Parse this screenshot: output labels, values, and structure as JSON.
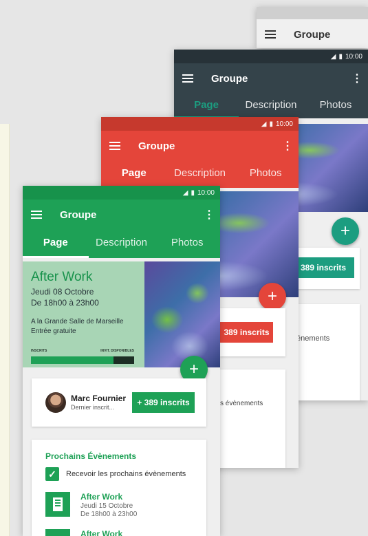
{
  "screen_4": {
    "app_title": "Groupe"
  },
  "screen_3": {
    "status_time": "10:00",
    "app_title": "Groupe",
    "tabs": [
      "Page",
      "Description",
      "Photos"
    ],
    "subscribers_button": "389 inscrits",
    "events_partial": "énements"
  },
  "screen_2": {
    "status_time": "10:00",
    "app_title": "Groupe",
    "tabs": [
      "Page",
      "Description",
      "Photos"
    ],
    "subscribers_button": "389 inscrits",
    "events_partial": "s évènements"
  },
  "screen_1": {
    "status_time": "10:00",
    "app_title": "Groupe",
    "tabs": [
      "Page",
      "Description",
      "Photos"
    ],
    "event": {
      "title": "After Work",
      "date": "Jeudi 08 Octobre",
      "time": "De 18h00 à 23h00",
      "location": "A la Grande Salle de Marseille",
      "price": "Entrée gratuite",
      "bar_left_label": "INSCRITS",
      "bar_right_label": "INVIT. DISPONIBLES",
      "fill_fraction": 0.8
    },
    "member": {
      "name": "Marc Fournier",
      "subtitle": "Dernier inscrit..."
    },
    "subscribers_button": "+ 389 inscrits",
    "upcoming": {
      "heading": "Prochains Évènements",
      "checkbox_label": "Recevoir les prochains évènements",
      "items": [
        {
          "title": "After Work",
          "date": "Jeudi 15 Octobre",
          "time": "De 18h00 à 23h00"
        },
        {
          "title": "After Work"
        }
      ]
    }
  },
  "colors": {
    "green": "#1ea156",
    "red": "#e4453a",
    "dark": "#34434a",
    "teal": "#1c9d80"
  },
  "icons": [
    "menu-icon",
    "more-vert-icon",
    "signal-icon",
    "battery-icon",
    "add-icon",
    "check-icon",
    "building-icon"
  ]
}
